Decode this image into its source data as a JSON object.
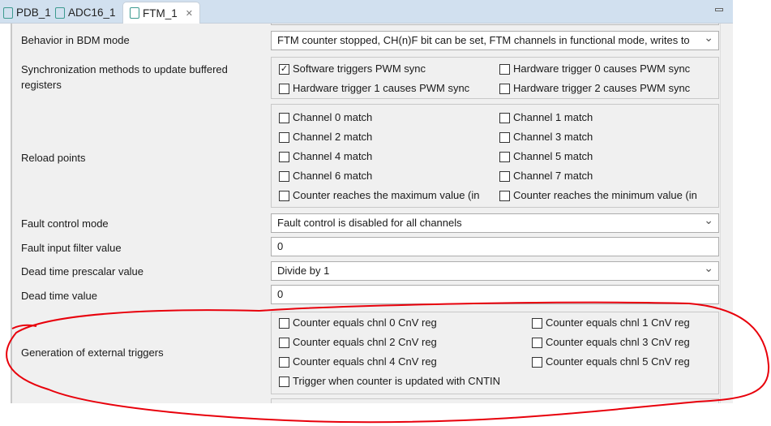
{
  "tabs": [
    {
      "label": "PDB_1"
    },
    {
      "label": "ADC16_1"
    },
    {
      "label": "FTM_1",
      "active": true
    }
  ],
  "rows": {
    "bdm": {
      "label": "Behavior in BDM mode",
      "value": "FTM counter stopped, CH(n)F bit can be set, FTM channels in functional mode, writes to"
    },
    "sync": {
      "label": "Synchronization methods to update buffered registers",
      "options": [
        {
          "label": "Software triggers PWM sync",
          "checked": true
        },
        {
          "label": "Hardware trigger 0 causes PWM sync",
          "checked": false
        },
        {
          "label": "Hardware trigger 1 causes PWM sync",
          "checked": false
        },
        {
          "label": "Hardware trigger 2 causes PWM sync",
          "checked": false
        }
      ]
    },
    "reload": {
      "label": "Reload points",
      "options": [
        {
          "label": "Channel 0 match"
        },
        {
          "label": "Channel 1 match"
        },
        {
          "label": "Channel 2 match"
        },
        {
          "label": "Channel 3 match"
        },
        {
          "label": "Channel 4 match"
        },
        {
          "label": "Channel 5 match"
        },
        {
          "label": "Channel 6 match"
        },
        {
          "label": "Channel 7 match"
        },
        {
          "label": "Counter reaches the maximum value (in"
        },
        {
          "label": "Counter reaches the minimum value (in"
        }
      ]
    },
    "fault_mode": {
      "label": "Fault control mode",
      "value": "Fault control is disabled for all channels"
    },
    "fault_filter": {
      "label": "Fault input filter value",
      "value": "0"
    },
    "dt_prescalar": {
      "label": "Dead time prescalar value",
      "value": "Divide by 1"
    },
    "dt_value": {
      "label": "Dead time value",
      "value": "0"
    },
    "ext_triggers": {
      "label": "Generation of external triggers",
      "options": [
        {
          "label": "Counter equals chnl 0 CnV reg"
        },
        {
          "label": "Counter equals chnl 1 CnV reg"
        },
        {
          "label": "Counter equals chnl 2 CnV reg"
        },
        {
          "label": "Counter equals chnl 3 CnV reg"
        },
        {
          "label": "Counter equals chnl 4 CnV reg"
        },
        {
          "label": "Counter equals chnl 5 CnV reg"
        },
        {
          "label": "Trigger when counter is updated with CNTIN"
        }
      ]
    }
  },
  "annotation_color": "#e8000b"
}
